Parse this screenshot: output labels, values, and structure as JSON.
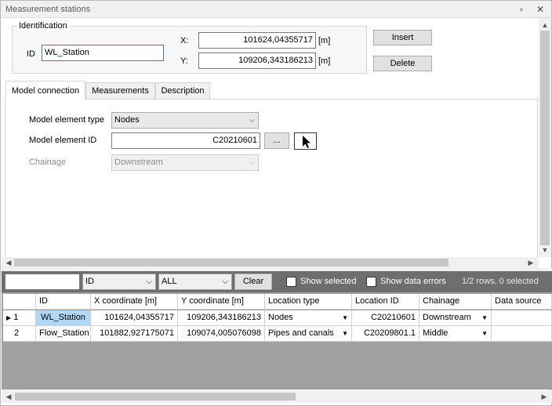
{
  "window": {
    "title": "Measurement stations",
    "restore_icon": "restore-icon",
    "close_icon": "close-icon"
  },
  "identification": {
    "legend": "Identification",
    "id_label": "ID",
    "id_value": "WL_Station",
    "x_label": "X:",
    "x_value": "101624,04355717",
    "x_unit": "[m]",
    "y_label": "Y:",
    "y_value": "109206,343186213",
    "y_unit": "[m]"
  },
  "actions": {
    "insert_label": "Insert",
    "delete_label": "Delete"
  },
  "tabs": [
    {
      "label": "Model connection",
      "active": true
    },
    {
      "label": "Measurements",
      "active": false
    },
    {
      "label": "Description",
      "active": false
    }
  ],
  "model_connection": {
    "element_type_label": "Model element type",
    "element_type_value": "Nodes",
    "element_id_label": "Model element ID",
    "element_id_value": "C20210601",
    "browse_label": "...",
    "pick_icon": "cursor-arrow-icon",
    "chainage_label": "Chainage",
    "chainage_value": "Downstream"
  },
  "grid_toolbar": {
    "filter_value": "",
    "column_select": "ID",
    "scope_select": "ALL",
    "clear_label": "Clear",
    "show_selected_label": "Show selected",
    "show_errors_label": "Show data errors",
    "status": "1/2 rows, 0 selected"
  },
  "grid": {
    "columns": [
      "ID",
      "X coordinate [m]",
      "Y coordinate [m]",
      "Location type",
      "Location ID",
      "Chainage",
      "Data source"
    ],
    "rows": [
      {
        "num": "1",
        "current": true,
        "id": "WL_Station",
        "x": "101624,04355717",
        "y": "109206,343186213",
        "location_type": "Nodes",
        "location_id": "C20210601",
        "chainage": "Downstream",
        "data_source": ""
      },
      {
        "num": "2",
        "current": false,
        "id": "Flow_Station",
        "x": "101882,927175071",
        "y": "109074,005076098",
        "location_type": "Pipes and canals",
        "location_id": "C20209801.1",
        "chainage": "Middle",
        "data_source": ""
      }
    ]
  },
  "colors": {
    "selected_cell": "#b0d8f5",
    "grid_toolbar_bg": "#6e6e6e",
    "grid_empty_bg": "#a0a0a0"
  }
}
